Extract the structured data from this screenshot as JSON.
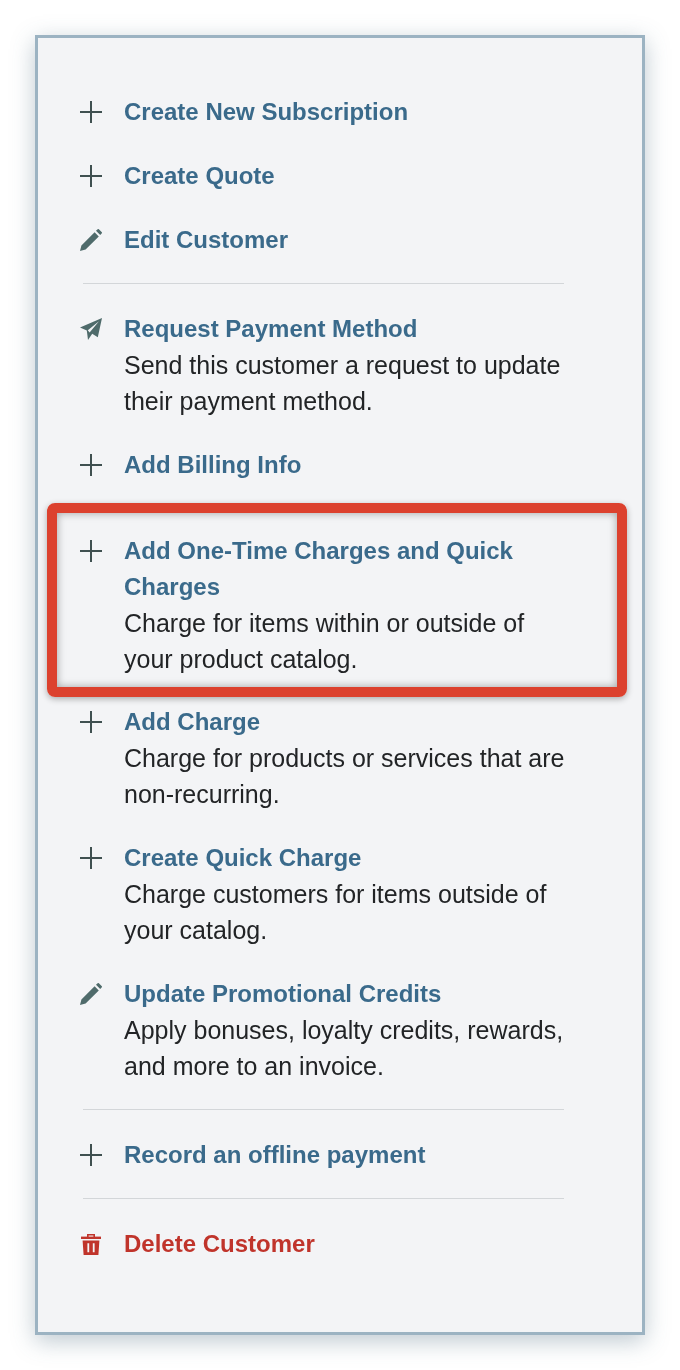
{
  "panel": {
    "sections": [
      {
        "items": [
          {
            "kind": "add",
            "label": "Create New Subscription",
            "highlighted": false
          },
          {
            "kind": "add",
            "label": "Create Quote",
            "highlighted": false
          },
          {
            "kind": "edit",
            "label": "Edit Customer",
            "highlighted": false
          }
        ]
      },
      {
        "items": [
          {
            "kind": "send",
            "label": "Request Payment Method",
            "description": "Send this customer a request to update their payment method.",
            "highlighted": false
          },
          {
            "kind": "add",
            "label": "Add Billing Info",
            "highlighted": false
          },
          {
            "kind": "add",
            "label": "Add One-Time Charges and Quick Charges",
            "description": "Charge for items within or outside of your product catalog.",
            "highlighted": true
          },
          {
            "kind": "add",
            "label": "Add Charge",
            "description": "Charge for products or services that are non-recurring.",
            "highlighted": false
          },
          {
            "kind": "add",
            "label": "Create Quick Charge",
            "description": "Charge customers for items outside of your catalog.",
            "highlighted": false
          },
          {
            "kind": "edit",
            "label": "Update Promotional Credits",
            "description": "Apply bonuses, loyalty credits, rewards, and more to an invoice.",
            "highlighted": false
          }
        ]
      },
      {
        "items": [
          {
            "kind": "add",
            "label": "Record an offline payment",
            "highlighted": false
          }
        ]
      },
      {
        "items": [
          {
            "kind": "delete",
            "label": "Delete Customer",
            "highlighted": false
          }
        ]
      }
    ]
  }
}
